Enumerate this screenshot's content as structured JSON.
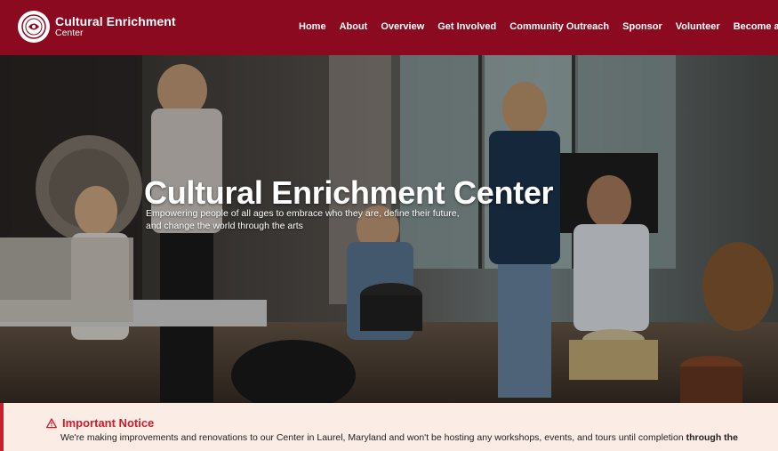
{
  "header": {
    "logo_title": "Cultural Enrichment",
    "logo_subtitle": "Center",
    "background_color": "#8b0a1f",
    "nav": [
      {
        "label": "Home"
      },
      {
        "label": "About"
      },
      {
        "label": "Overview"
      },
      {
        "label": "Get Involved"
      },
      {
        "label": "Community Outreach"
      },
      {
        "label": "Sponsor"
      },
      {
        "label": "Volunteer"
      },
      {
        "label": "Become a M"
      }
    ]
  },
  "hero": {
    "title": "Cultural Enrichment Center",
    "subtitle": "Empowering people of all ages to embrace who they are, define their future, and change the world through the arts",
    "image_icon": "children-playing-instruments-photo"
  },
  "notice": {
    "heading": "Important Notice",
    "icon": "warning-icon",
    "accent_color": "#c81e2e",
    "body": "We're making improvements and renovations to our Center in Laurel, Maryland and won't be hosting any workshops, events, and tours until completion ",
    "body_bold": "through the"
  }
}
